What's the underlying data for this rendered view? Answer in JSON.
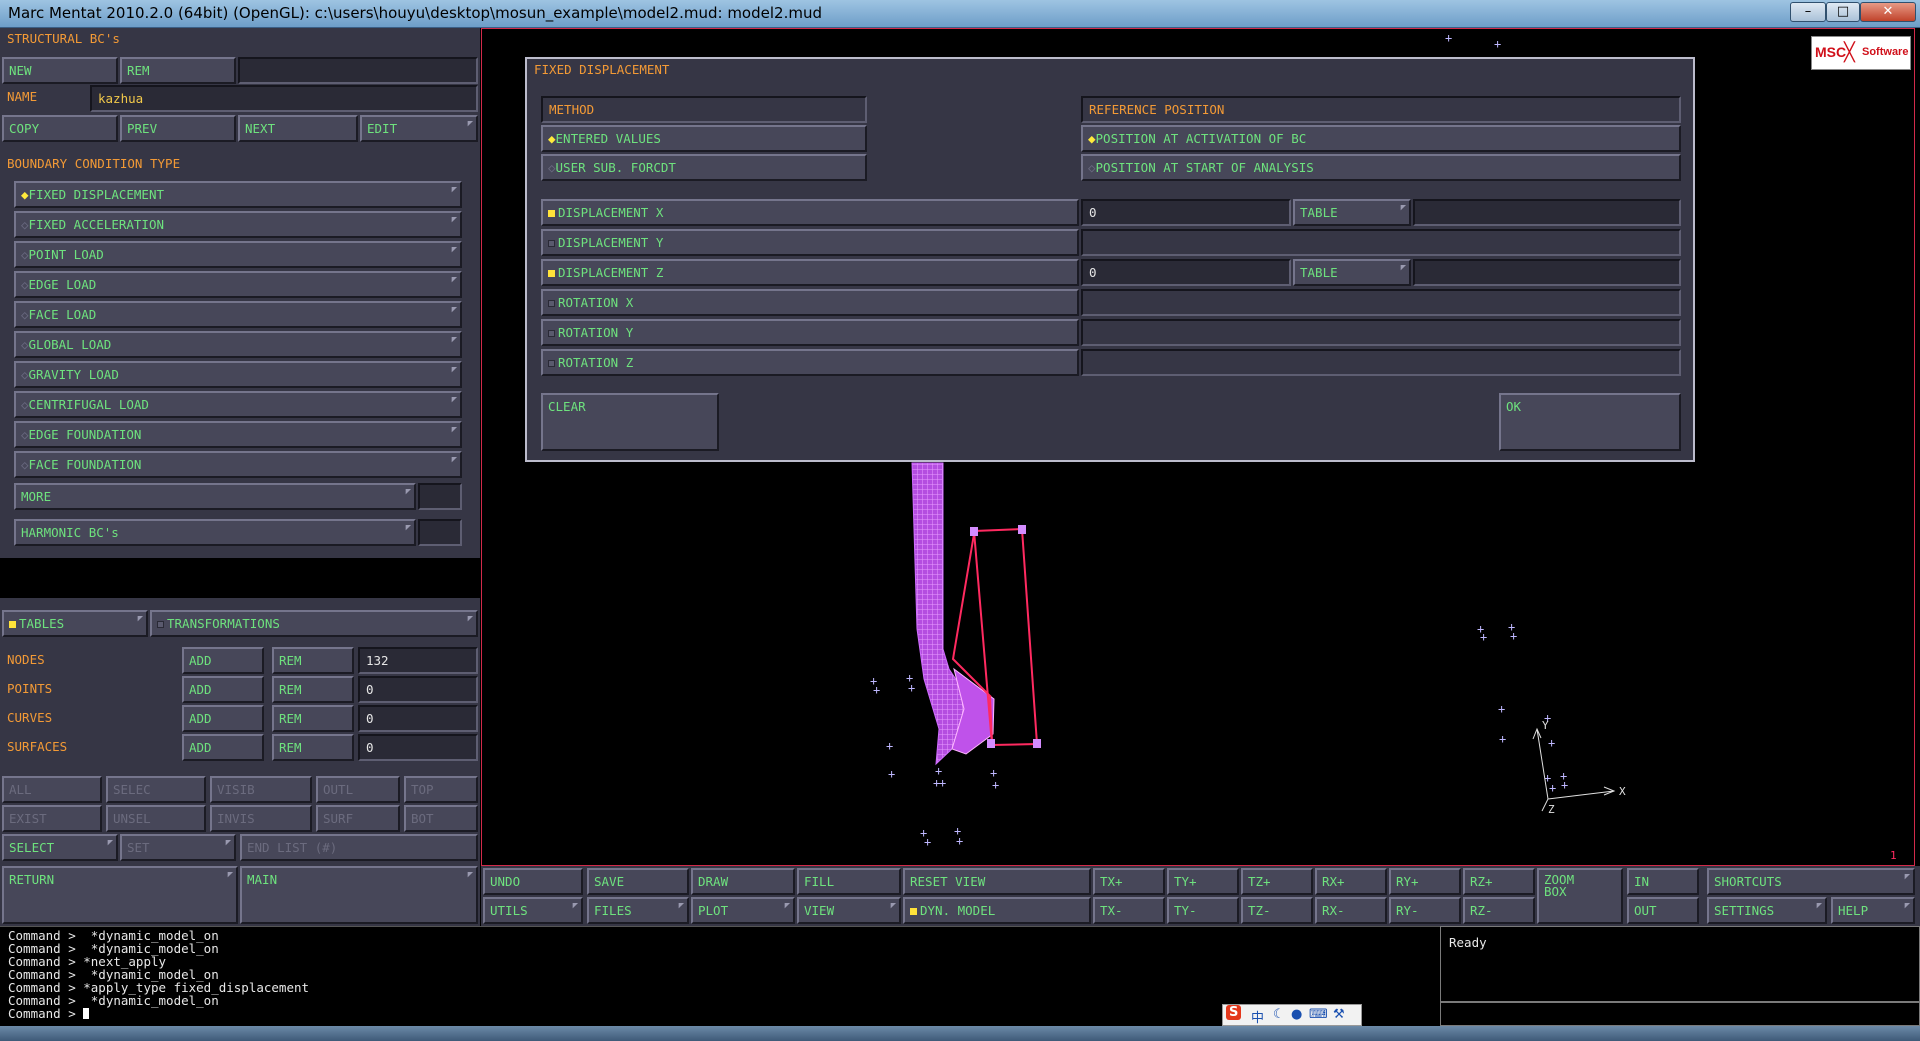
{
  "window": {
    "title": "Marc Mentat 2010.2.0 (64bit) (OpenGL): c:\\users\\houyu\\desktop\\mosun_example\\model2.mud: model2.mud"
  },
  "panel": {
    "heading": "STRUCTURAL BC's",
    "new": "NEW",
    "rem": "REM",
    "name_label": "NAME",
    "name_value": "kazhua",
    "copy": "COPY",
    "prev": "PREV",
    "next": "NEXT",
    "edit": "EDIT",
    "bc_type_heading": "BOUNDARY CONDITION TYPE",
    "bc_types": [
      "FIXED DISPLACEMENT",
      "FIXED ACCELERATION",
      "POINT LOAD",
      "EDGE LOAD",
      "FACE LOAD",
      "GLOBAL LOAD",
      "GRAVITY LOAD",
      "CENTRIFUGAL LOAD",
      "EDGE FOUNDATION",
      "FACE FOUNDATION"
    ],
    "more": "MORE",
    "harmonic": "HARMONIC BC's",
    "tables": "TABLES",
    "transformations": "TRANSFORMATIONS",
    "entities": [
      {
        "label": "NODES",
        "add": "ADD",
        "rem": "REM",
        "count": "132"
      },
      {
        "label": "POINTS",
        "add": "ADD",
        "rem": "REM",
        "count": "0"
      },
      {
        "label": "CURVES",
        "add": "ADD",
        "rem": "REM",
        "count": "0"
      },
      {
        "label": "SURFACES",
        "add": "ADD",
        "rem": "REM",
        "count": "0"
      }
    ],
    "sel_row1": [
      "ALL",
      "SELEC",
      "VISIB",
      "OUTL",
      "TOP"
    ],
    "sel_row2": [
      "EXIST",
      "UNSEL",
      "INVIS",
      "SURF",
      "BOT"
    ],
    "select": "SELECT",
    "set": "SET",
    "end_list": "END LIST (#)",
    "return": "RETURN",
    "main": "MAIN"
  },
  "dialog": {
    "title": "FIXED DISPLACEMENT",
    "method_heading": "METHOD",
    "entered_values": "ENTERED VALUES",
    "user_sub": "USER SUB. FORCDT",
    "ref_heading": "REFERENCE POSITION",
    "ref_activation": "POSITION AT ACTIVATION OF BC",
    "ref_start": "POSITION AT START OF ANALYSIS",
    "dofs": [
      {
        "label": "DISPLACEMENT X",
        "value": "0",
        "table": "TABLE"
      },
      {
        "label": "DISPLACEMENT Y",
        "value": "",
        "table": ""
      },
      {
        "label": "DISPLACEMENT Z",
        "value": "0",
        "table": "TABLE"
      },
      {
        "label": "ROTATION X",
        "value": "",
        "table": ""
      },
      {
        "label": "ROTATION Y",
        "value": "",
        "table": ""
      },
      {
        "label": "ROTATION Z",
        "value": "",
        "table": ""
      }
    ],
    "clear": "CLEAR",
    "ok": "OK"
  },
  "viewport": {
    "logo_msc": "MSC",
    "logo_software": "Software",
    "axis_x": "X",
    "axis_y": "Y",
    "axis_z": "Z",
    "window_number": "1"
  },
  "toolbar": {
    "undo": "UNDO",
    "save": "SAVE",
    "draw": "DRAW",
    "fill": "FILL",
    "reset_view": "RESET VIEW",
    "tx_plus": "TX+",
    "ty_plus": "TY+",
    "tz_plus": "TZ+",
    "rx_plus": "RX+",
    "ry_plus": "RY+",
    "rz_plus": "RZ+",
    "zoom_box_1": "ZOOM",
    "zoom_box_2": "BOX",
    "in": "IN",
    "shortcuts": "SHORTCUTS",
    "utils": "UTILS",
    "files": "FILES",
    "plot": "PLOT",
    "view": "VIEW",
    "dyn_model": "DYN. MODEL",
    "tx_minus": "TX-",
    "ty_minus": "TY-",
    "tz_minus": "TZ-",
    "rx_minus": "RX-",
    "ry_minus": "RY-",
    "rz_minus": "RZ-",
    "out": "OUT",
    "settings": "SETTINGS",
    "help": "HELP"
  },
  "console": {
    "lines": [
      "Command >  *dynamic_model_on",
      "Command >  *dynamic_model_on",
      "Command > *next_apply",
      "Command >  *dynamic_model_on",
      "Command > *apply_type fixed_displacement",
      "Command >  *dynamic_model_on",
      "Command > "
    ],
    "status": "Ready"
  },
  "ime": {
    "logo": "S",
    "lang": "中"
  },
  "colors": {
    "panel": "#363645",
    "button": "#474759",
    "button_text": "#6ee27e",
    "label": "#f39a36",
    "mesh": "#cc55ee",
    "edge": "#ff2a60",
    "border": "#d22a4a"
  }
}
